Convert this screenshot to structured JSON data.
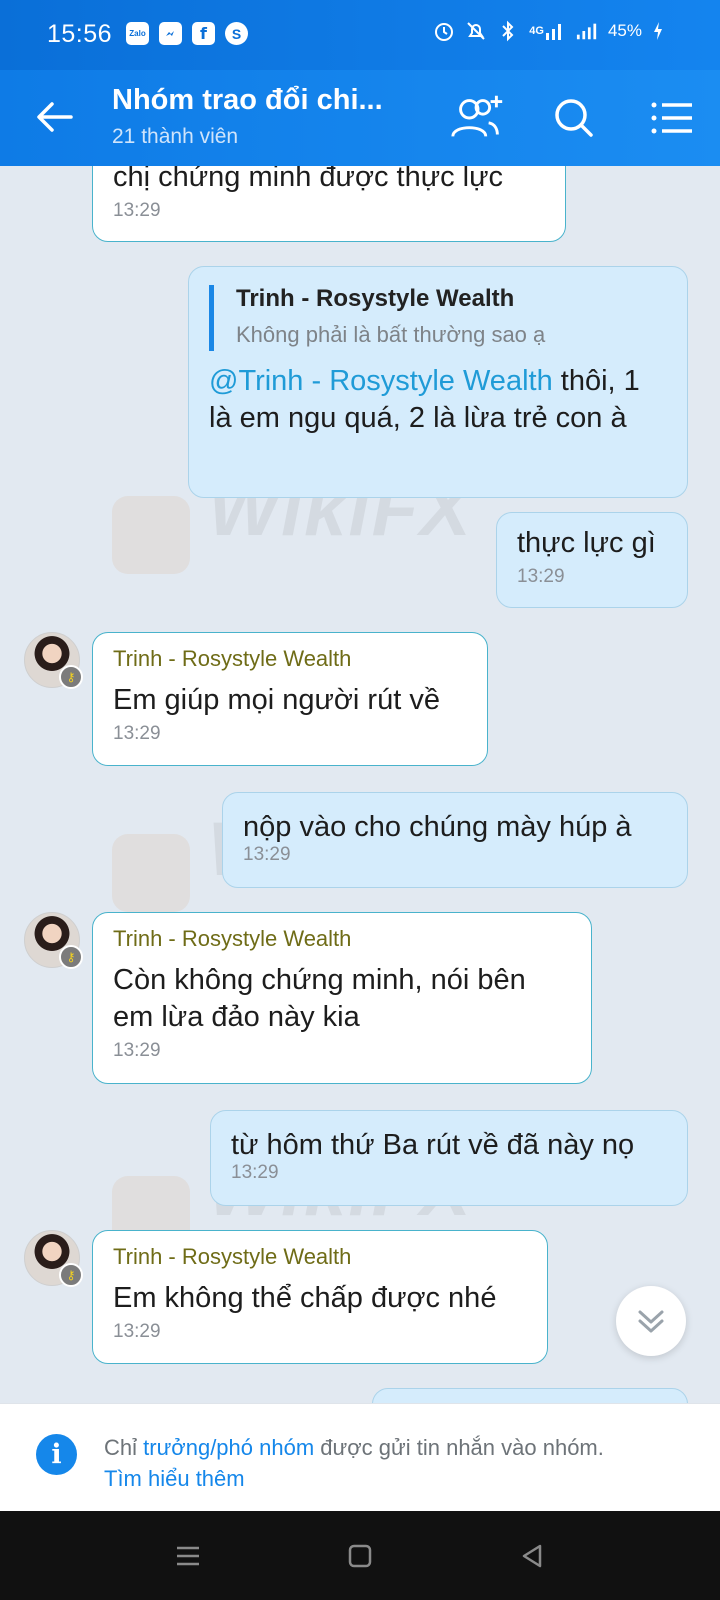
{
  "status_bar": {
    "time": "15:56",
    "apps": [
      "Zalo",
      "messenger-icon",
      "facebook-icon",
      "skype-icon"
    ],
    "network": "4G",
    "battery": "45%"
  },
  "header": {
    "title": "Nhóm trao đổi chi...",
    "subtitle": "21 thành viên"
  },
  "messages": [
    {
      "direction": "in",
      "text": "chị chứng minh được thực lực",
      "time": "13:29"
    },
    {
      "direction": "out",
      "quote_name": "Trinh - Rosystyle Wealth",
      "quote_text": "Không phải là bất thường sao ạ",
      "mention": "@Trinh - Rosystyle Wealth",
      "text": " thôi, 1 là em ngu quá, 2 là lừa trẻ con à"
    },
    {
      "direction": "out",
      "text": "thực lực gì",
      "time": "13:29"
    },
    {
      "direction": "in",
      "sender": "Trinh - Rosystyle Wealth",
      "text": "Em giúp mọi người rút về",
      "time": "13:29"
    },
    {
      "direction": "out",
      "text": "nộp vào cho chúng mày húp à",
      "time": "13:29"
    },
    {
      "direction": "in",
      "sender": "Trinh - Rosystyle Wealth",
      "text": "Còn không chứng minh, nói bên em lừa đảo này kia",
      "time": "13:29"
    },
    {
      "direction": "out",
      "text": "từ hôm thứ Ba rút về đã này nọ",
      "time": "13:29"
    },
    {
      "direction": "in",
      "sender": "Trinh - Rosystyle Wealth",
      "text": "Em không thể chấp được nhé",
      "time": "13:29"
    }
  ],
  "watermark": "WikiFX",
  "notice": {
    "prefix": "Chỉ ",
    "role_link": "trưởng/phó nhóm",
    "suffix": " được gửi tin nhắn vào nhóm.",
    "learn_more": "Tìm hiểu thêm"
  },
  "colors": {
    "header": "#1484ef",
    "chat_bg": "#e2e9f1",
    "incoming_bubble": "#ffffff",
    "outgoing_bubble": "#d5ecfc",
    "sender_name": "#6f6c17",
    "link": "#1587ea"
  }
}
